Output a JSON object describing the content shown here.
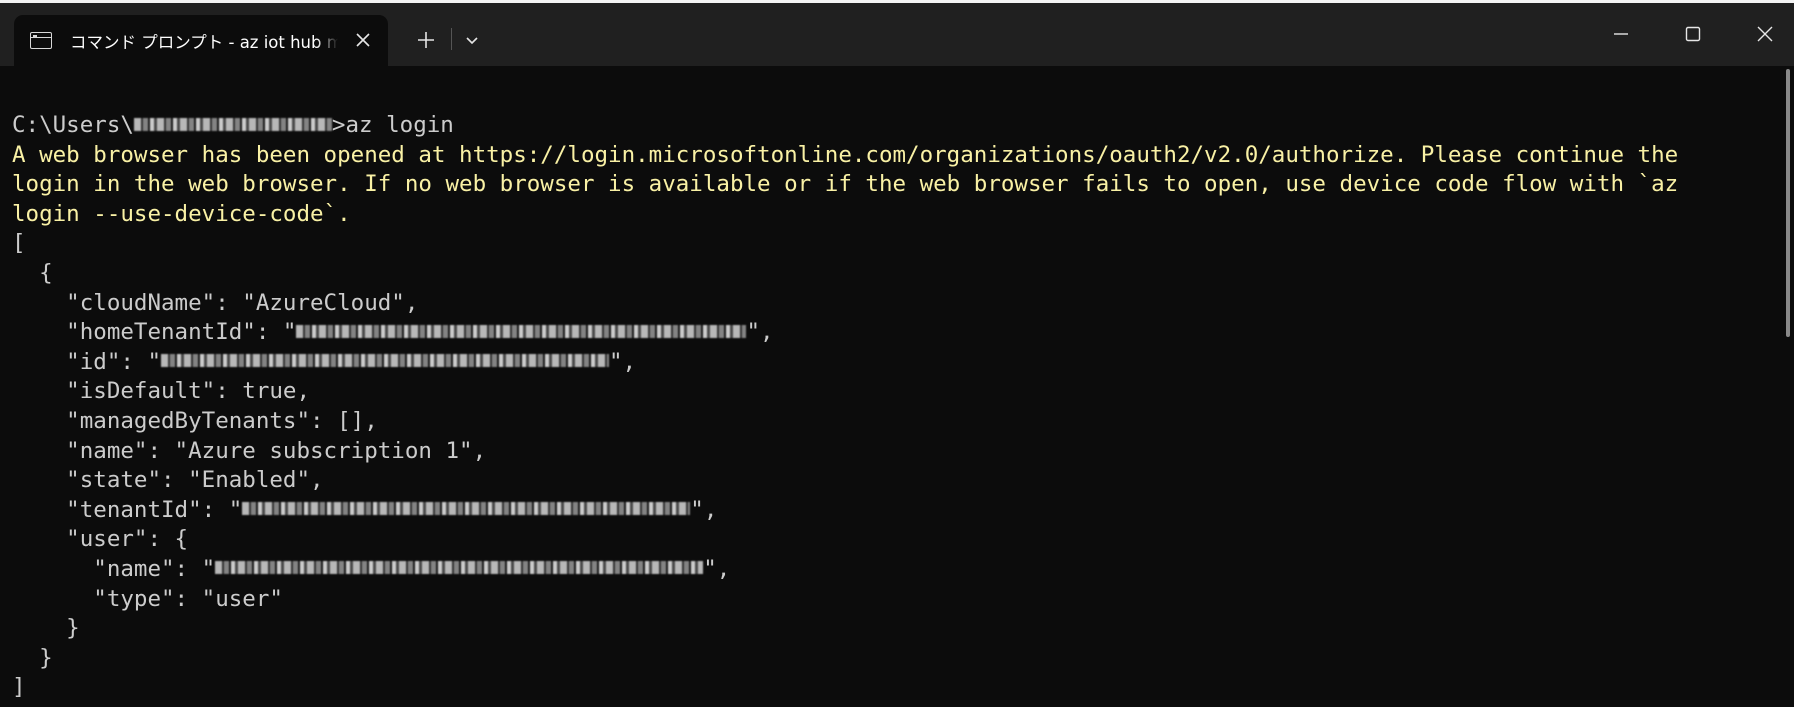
{
  "window": {
    "tab_title": "コマンド プロンプト - az  iot hub m",
    "tab_icon": "console-icon",
    "controls": {
      "new_tab": "+",
      "close_tab": "✕"
    }
  },
  "colors": {
    "background": "#0c0c0c",
    "titlebar": "#202020",
    "default_text": "#cccccc",
    "warning_text": "#f9f1a5"
  },
  "terminal": {
    "prompt_prefix": "C:\\Users\\",
    "prompt_suffix": ">az login",
    "warning_lines": [
      "A web browser has been opened at https://login.microsoftonline.com/organizations/oauth2/v2.0/authorize. Please continue the",
      "login in the web browser. If no web browser is available or if the web browser fails to open, use device code flow with `az",
      "login --use-device-code`."
    ],
    "output": {
      "open_bracket": "[",
      "open_brace": "  {",
      "cloud_name": "    \"cloudName\": \"AzureCloud\",",
      "home_tenant_prefix": "    \"homeTenantId\": \"",
      "home_tenant_suffix": "\",",
      "id_prefix": "    \"id\": \"",
      "id_suffix": "\",",
      "is_default": "    \"isDefault\": true,",
      "managed_by": "    \"managedByTenants\": [],",
      "name": "    \"name\": \"Azure subscription 1\",",
      "state": "    \"state\": \"Enabled\",",
      "tenant_prefix": "    \"tenantId\": \"",
      "tenant_suffix": "\",",
      "user_open": "    \"user\": {",
      "user_name_prefix": "      \"name\": \"",
      "user_name_suffix": "\",",
      "user_type": "      \"type\": \"user\"",
      "user_close": "    }",
      "close_brace": "  }",
      "close_bracket": "]"
    }
  }
}
